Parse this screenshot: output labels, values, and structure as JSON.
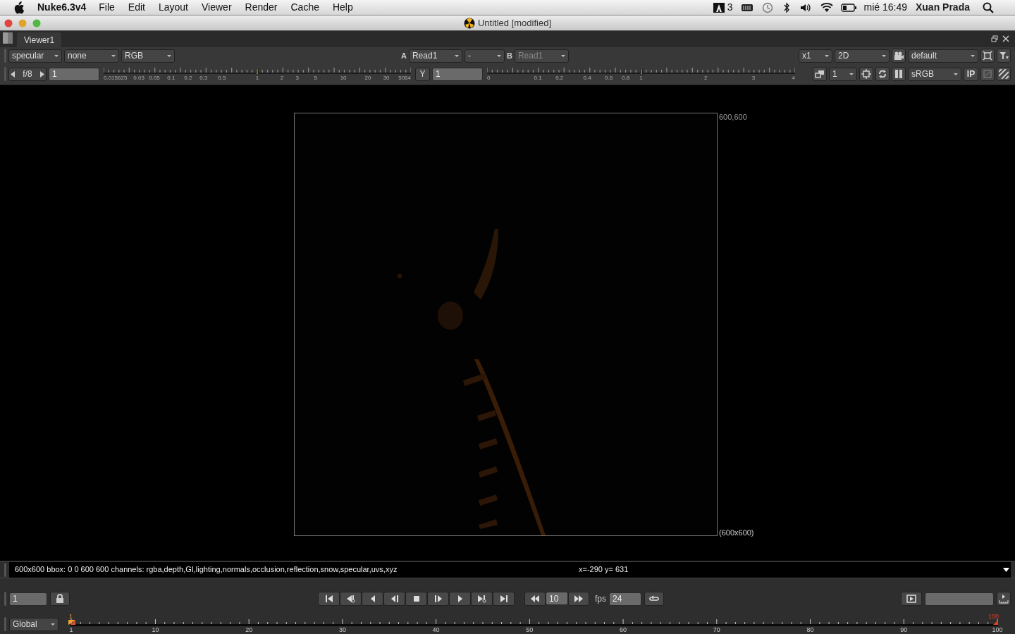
{
  "menu_bar": {
    "app_name": "Nuke6.3v4",
    "menus": [
      "File",
      "Edit",
      "Layout",
      "Viewer",
      "Render",
      "Cache",
      "Help"
    ],
    "status_badge": "3",
    "clock": "mié 16:49",
    "user": "Xuan Prada"
  },
  "window": {
    "title": "Untitled [modified]"
  },
  "tabs": [
    {
      "label": "Viewer1",
      "selected": true
    }
  ],
  "viewer_controls": {
    "channels": "specular",
    "channel_alpha": "none",
    "display_channels": "RGB",
    "input_a_label": "A",
    "input_a": "Read1",
    "wipe_op": "-",
    "input_b_label": "B",
    "input_b": "Read1",
    "input_b_disabled": true,
    "zoom": "x1",
    "view_mode": "2D",
    "lut": "default",
    "fstop": "f/8",
    "gain_value": "1",
    "gain_slider": {
      "level": 0.5,
      "ticks": [
        "0.015625",
        "0.03",
        "0.05",
        "0.1",
        "0.2",
        "0.3",
        "0.5",
        "1",
        "2",
        "3",
        "5",
        "10",
        "20",
        "30",
        "5064"
      ]
    },
    "gamma_button": "Y",
    "gamma_value": "1",
    "gamma_slider": {
      "level": 0.5,
      "ticks": [
        "0",
        "0.1",
        "0.2",
        "0.4",
        "0.6",
        "0.8",
        "1",
        "2",
        "3",
        "4"
      ]
    },
    "proxy": "1",
    "colorspace": "sRGB",
    "ip_button": "IP"
  },
  "viewer": {
    "format_label": "600,600",
    "format_size": "(600x600)"
  },
  "info_bar": {
    "info": "600x600 bbox: 0 0 600 600 channels: rgba,depth,GI,lighting,normals,occlusion,reflection,snow,specular,uvs,xyz",
    "coords": "x=-290 y= 631"
  },
  "playback": {
    "frame": "1",
    "increment": "10",
    "fps_label": "fps",
    "fps": "24"
  },
  "timeline": {
    "range": "Global",
    "in_marker": "1",
    "out_marker": "100",
    "labels": [
      "1",
      "10",
      "20",
      "30",
      "40",
      "50",
      "60",
      "70",
      "80",
      "90",
      "100"
    ]
  }
}
